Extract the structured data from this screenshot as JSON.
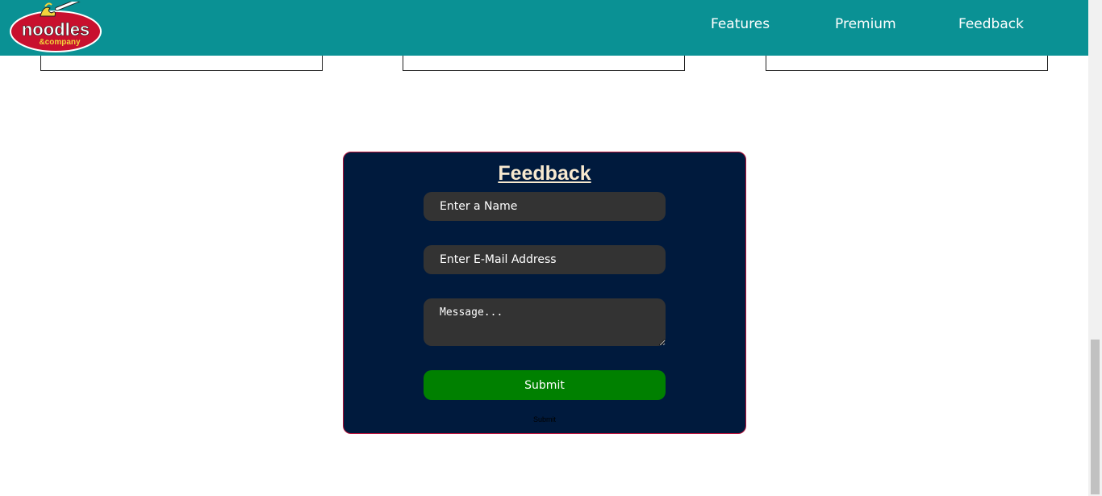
{
  "header": {
    "logo": {
      "text_main": "noodles",
      "text_sub": "&company",
      "colors": {
        "badge": "#c8102e",
        "text": "#ffffff",
        "noodles": "#f3d33b"
      }
    },
    "nav": [
      {
        "label": "Features"
      },
      {
        "label": "Premium"
      },
      {
        "label": "Feedback"
      }
    ],
    "background_color": "#0a9194"
  },
  "feedback_form": {
    "title": "Feedback",
    "name_placeholder": "Enter a Name",
    "email_placeholder": "Enter E-Mail Address",
    "message_placeholder": "Message...",
    "submit_label": "Submit",
    "secondary_submit_label": "Submit",
    "colors": {
      "panel": "#001a3d",
      "border": "#b3123a",
      "input": "#333333",
      "button": "#008000",
      "title": "#f8e9cf"
    }
  }
}
